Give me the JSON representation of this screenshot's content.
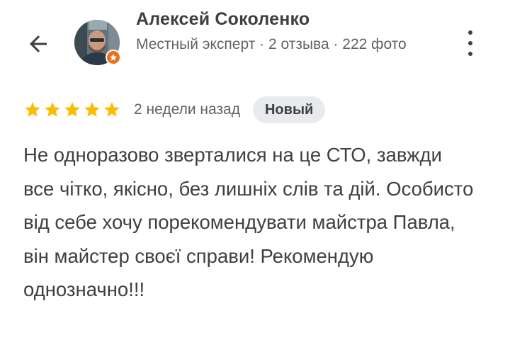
{
  "review": {
    "author": {
      "name": "Алексей Соколенко",
      "meta": "Местный эксперт · 2 отзыва · 222 фото",
      "badge_icon": "local-guide-star-icon",
      "badge_color": "#e8711a"
    },
    "rating": 5,
    "rating_max": 5,
    "star_color": "#fbbc04",
    "date": "2 недели назад",
    "tag": "Новый",
    "text": "Не одноразово зверталися на це СТО, завжди все чітко, якісно, без лишніх слів та дій. Особисто від себе хочу порекомендувати майстра Павла, він майстер своєї справи! Рекомендую однозначно!!!"
  },
  "icons": {
    "back": "arrow-back-icon",
    "more": "more-vertical-icon",
    "star": "star-icon"
  }
}
